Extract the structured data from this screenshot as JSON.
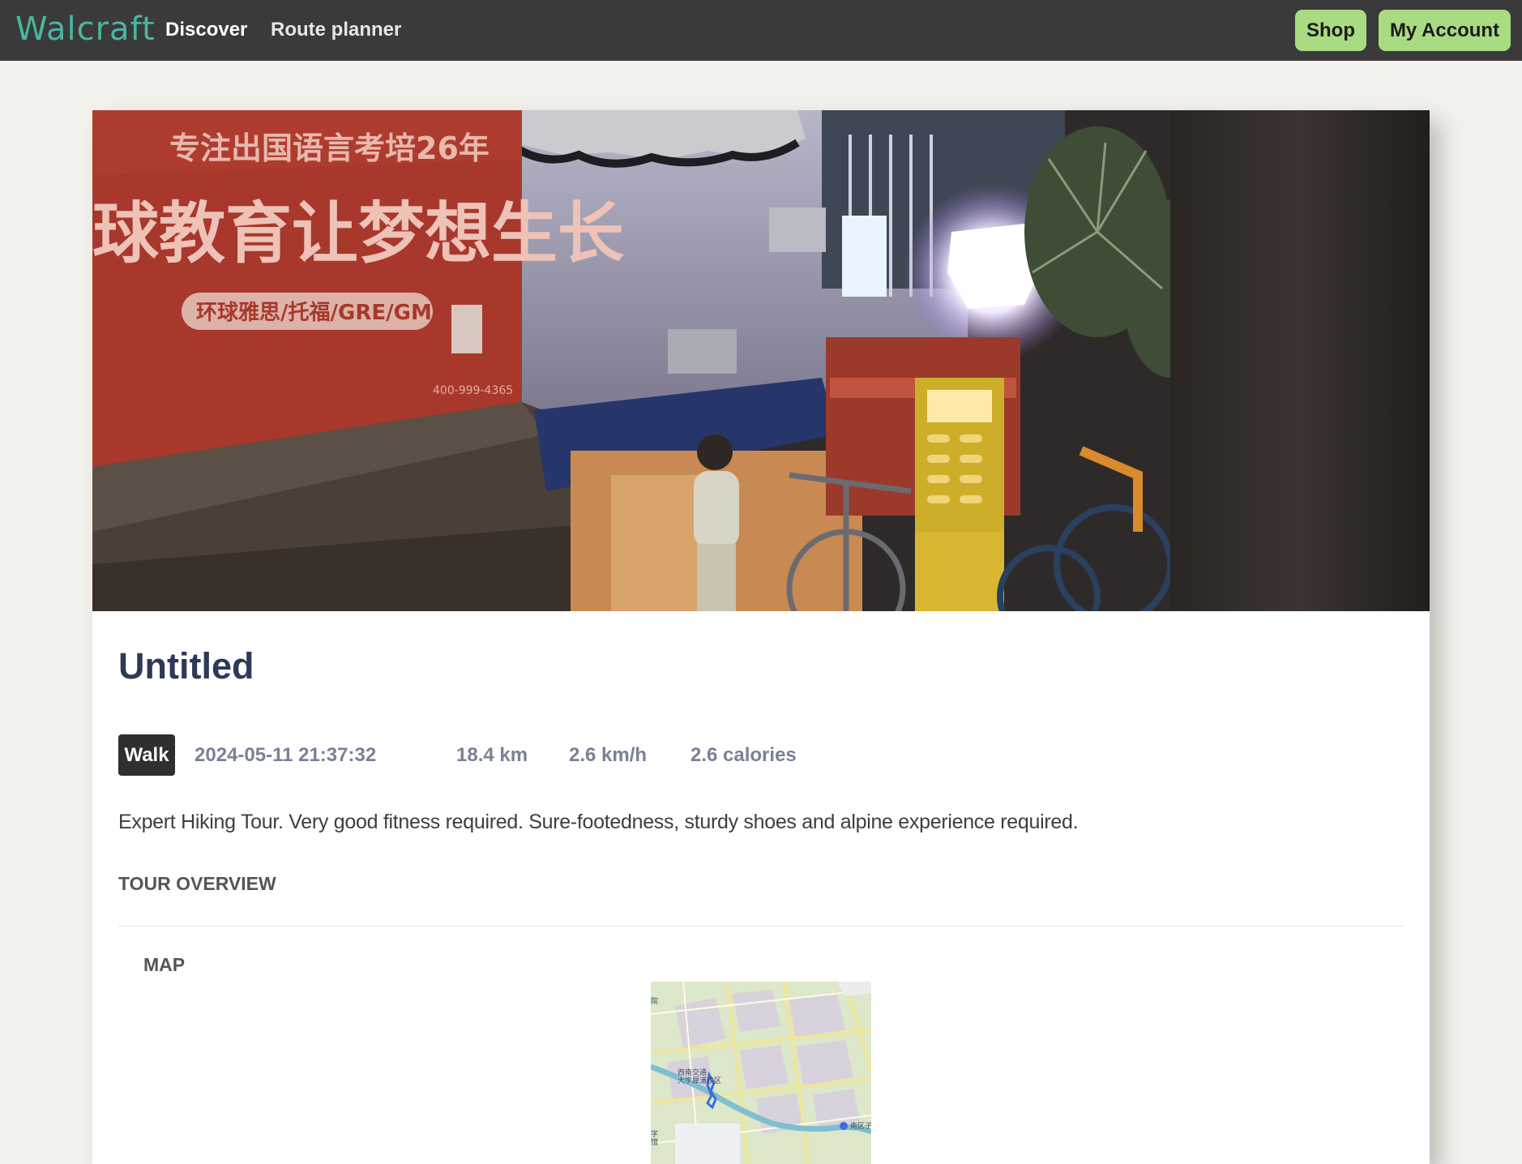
{
  "navbar": {
    "logo": "Walcraft",
    "links": [
      "Discover",
      "Route planner"
    ],
    "shop_label": "Shop",
    "account_label": "My Account",
    "accent_color": "#a9dc82",
    "logo_color": "#4ab5a2"
  },
  "tour": {
    "title": "Untitled",
    "sport": "Walk",
    "datetime": "2024-05-11 21:37:32",
    "distance": "18.4 km",
    "speed": "2.6 km/h",
    "calories": "2.6 calories",
    "description": "Expert Hiking Tour. Very good fitness required. Sure-footedness, sturdy shoes and alpine experience required.",
    "overview_heading": "TOUR OVERVIEW",
    "map_heading": "MAP"
  },
  "hero_photo": {
    "signboard_line_1": "专注出国语言考培26年",
    "signboard_line_2": "球教育让梦想生长",
    "signboard_line_3": "环球雅思/托福/GRE/GMAT",
    "signboard_phone": "400-999-4365"
  },
  "map": {
    "label_campus": "西南交通\n大学犀浦校区",
    "label_district": "南区子",
    "label_top_left": "院",
    "label_bottom_left": "字\n馆"
  }
}
